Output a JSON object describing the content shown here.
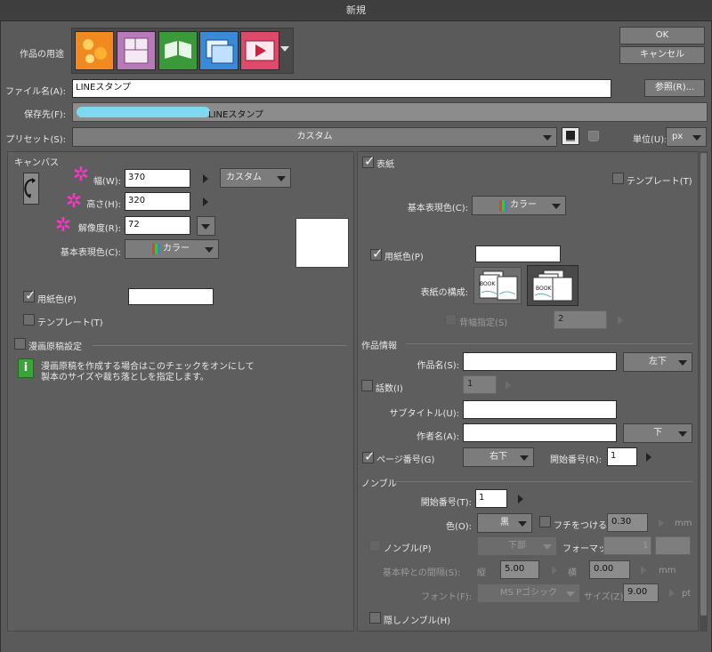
{
  "window": {
    "title": "新規"
  },
  "header": {
    "usage_label": "作品の用途",
    "usage_icons": [
      "illustration-icon",
      "comic-icon",
      "book-icon",
      "picture-icon",
      "animation-icon"
    ],
    "ok": "OK",
    "cancel": "キャンセル",
    "filename_label": "ファイル名(A):",
    "filename_value": "LINEスタンプ",
    "browse": "参照(R)...",
    "savepath_label": "保存先(F):",
    "savepath_value": "LINEスタンプ",
    "preset_label": "プリセット(S):",
    "preset_value": "カスタム",
    "unit_label": "単位(U):",
    "unit_value": "px"
  },
  "canvas": {
    "section": "キャンバス",
    "width_label": "幅(W):",
    "width_value": "370",
    "height_label": "高さ(H):",
    "height_value": "320",
    "resolution_label": "解像度(R):",
    "resolution_value": "72",
    "size_preset": "カスタム",
    "color_mode_label": "基本表現色(C):",
    "color_mode_value": "カラー",
    "paper_color_label": "用紙色(P)",
    "template_label": "テンプレート(T)",
    "comic_setting_label": "漫画原稿設定",
    "comic_info_line1": "漫画原稿を作成する場合はこのチェックをオンにして",
    "comic_info_line2": "製本のサイズや裁ち落としを指定します。"
  },
  "cover": {
    "cover_label": "表紙",
    "template_label": "テンプレート(T)",
    "color_mode_label": "基本表現色(C):",
    "color_mode_value": "カラー",
    "paper_color_label": "用紙色(P)",
    "composition_label": "表紙の構成:",
    "book_badge": "BOOK",
    "spine_label": "背幅指定(S)",
    "spine_value": "2"
  },
  "work_info": {
    "section": "作品情報",
    "title_label": "作品名(S):",
    "title_position": "左下",
    "episode_label": "話数(I)",
    "episode_value": "1",
    "subtitle_label": "サブタイトル(U):",
    "author_label": "作者名(A):",
    "author_position": "下",
    "page_number_label": "ページ番号(G)",
    "page_number_position": "右下",
    "start_number_label": "開始番号(R):",
    "start_number_value": "1"
  },
  "nombre": {
    "section": "ノンブル",
    "start_label": "開始番号(T):",
    "start_value": "1",
    "color_label": "色(O):",
    "color_value": "黒",
    "border_label": "フチをつける(E)",
    "border_value": "0.30",
    "border_unit": "mm",
    "nombre_label": "ノンブル(P)",
    "position_value": "下部",
    "format_label": "フォーマット:",
    "format_value": "1",
    "gap_label": "基本枠との間隔(S):",
    "gap_v_label": "縦",
    "gap_v_value": "5.00",
    "gap_h_label": "横",
    "gap_h_value": "0.00",
    "gap_unit": "mm",
    "font_label": "フォント(F):",
    "font_value": "MS Pゴシック",
    "size_label": "サイズ(Z):",
    "size_value": "9.00",
    "size_unit": "pt",
    "hidden_label": "隠しノンブル(H)"
  },
  "colors": {
    "titlebar": "#3e3e3e",
    "panel": "#5a5a5a",
    "marker": "#ff33cc",
    "redaction": "#7fd7f0"
  }
}
